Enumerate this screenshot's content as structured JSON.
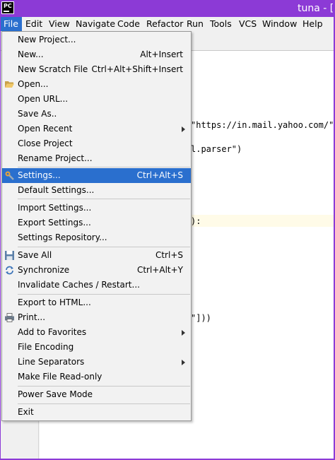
{
  "window": {
    "title": "tuna - [",
    "app_icon": "pycharm-logo-icon",
    "app_icon_text": "PC"
  },
  "menubar": [
    "File",
    "Edit",
    "View",
    "Navigate",
    "Code",
    "Refactor",
    "Run",
    "Tools",
    "VCS",
    "Window",
    "Help"
  ],
  "code_lines": [
    "\"https://in.mail.yahoo.com/\")",
    "l.parser\")",
    "):",
    "\"]))"
  ],
  "file_menu": [
    {
      "label": "New Project...",
      "shortcut": ""
    },
    {
      "label": "New...",
      "shortcut": "Alt+Insert"
    },
    {
      "label": "New Scratch File",
      "shortcut": "Ctrl+Alt+Shift+Insert"
    },
    {
      "label": "Open...",
      "shortcut": "",
      "icon": "folder-open-icon"
    },
    {
      "label": "Open URL...",
      "shortcut": ""
    },
    {
      "label": "Save As..",
      "shortcut": ""
    },
    {
      "label": "Open Recent",
      "shortcut": "",
      "submenu": true
    },
    {
      "label": "Close Project",
      "shortcut": ""
    },
    {
      "label": "Rename Project...",
      "shortcut": ""
    },
    {
      "label": "Settings...",
      "shortcut": "Ctrl+Alt+S",
      "icon": "wrench-icon",
      "selected": true
    },
    {
      "label": "Default Settings...",
      "shortcut": ""
    },
    {
      "label": "Import Settings...",
      "shortcut": ""
    },
    {
      "label": "Export Settings...",
      "shortcut": ""
    },
    {
      "label": "Settings Repository...",
      "shortcut": ""
    },
    {
      "label": "Save All",
      "shortcut": "Ctrl+S",
      "icon": "save-all-icon"
    },
    {
      "label": "Synchronize",
      "shortcut": "Ctrl+Alt+Y",
      "icon": "sync-icon"
    },
    {
      "label": "Invalidate Caches / Restart...",
      "shortcut": ""
    },
    {
      "label": "Export to HTML...",
      "shortcut": ""
    },
    {
      "label": "Print...",
      "shortcut": "",
      "icon": "printer-icon"
    },
    {
      "label": "Add to Favorites",
      "shortcut": "",
      "submenu": true
    },
    {
      "label": "File Encoding",
      "shortcut": ""
    },
    {
      "label": "Line Separators",
      "shortcut": "",
      "submenu": true
    },
    {
      "label": "Make File Read-only",
      "shortcut": ""
    },
    {
      "label": "Power Save Mode",
      "shortcut": ""
    },
    {
      "label": "Exit",
      "shortcut": ""
    }
  ],
  "colors": {
    "titlebar": "#8c3ad6",
    "selection": "#2a6fce",
    "string": "#067d17"
  }
}
